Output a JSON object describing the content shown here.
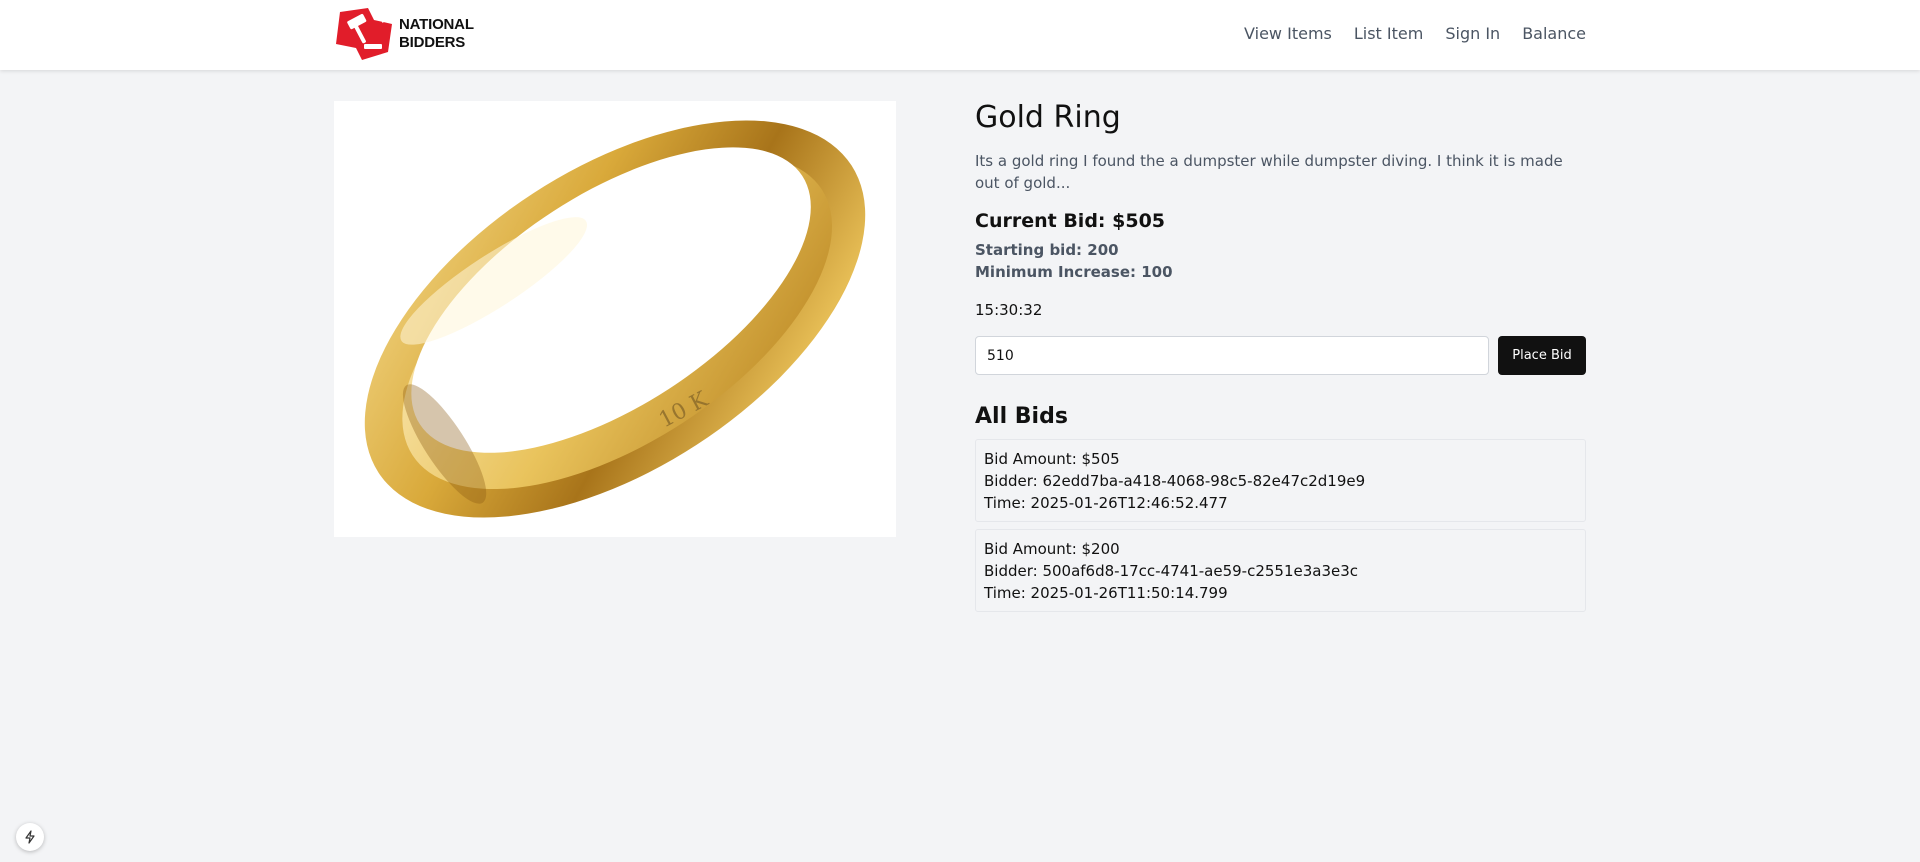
{
  "brand": {
    "line1": "NATIONAL",
    "line2": "BIDDERS",
    "logo_icon": "gavel-icon",
    "logo_color": "#e11d2a"
  },
  "nav": {
    "items": [
      {
        "label": "View Items"
      },
      {
        "label": "List Item"
      },
      {
        "label": "Sign In"
      },
      {
        "label": "Balance"
      }
    ]
  },
  "item": {
    "title": "Gold Ring",
    "description": "Its a gold ring I found the a dumpster while dumpster diving. I think it is made out of gold...",
    "current_bid": "Current Bid: $505",
    "starting_bid": "Starting bid: 200",
    "minimum_increase": "Minimum Increase: 100",
    "countdown": "15:30:32",
    "engraving": "10 K",
    "image_icon": "gold-ring-image"
  },
  "bid_form": {
    "value": "510",
    "button_label": "Place Bid"
  },
  "bids": {
    "heading": "All Bids",
    "items": [
      {
        "amount": "Bid Amount: $505",
        "bidder": "Bidder: 62edd7ba-a418-4068-98c5-82e47c2d19e9",
        "time": "Time: 2025-01-26T12:46:52.477"
      },
      {
        "amount": "Bid Amount: $200",
        "bidder": "Bidder: 500af6d8-17cc-4741-ae59-c2551e3a3e3c",
        "time": "Time: 2025-01-26T11:50:14.799"
      }
    ]
  },
  "dev_badge": {
    "icon": "lightning-icon"
  },
  "colors": {
    "accent_button": "#111111",
    "background": "#f3f4f6",
    "gold": "#d4a017"
  }
}
